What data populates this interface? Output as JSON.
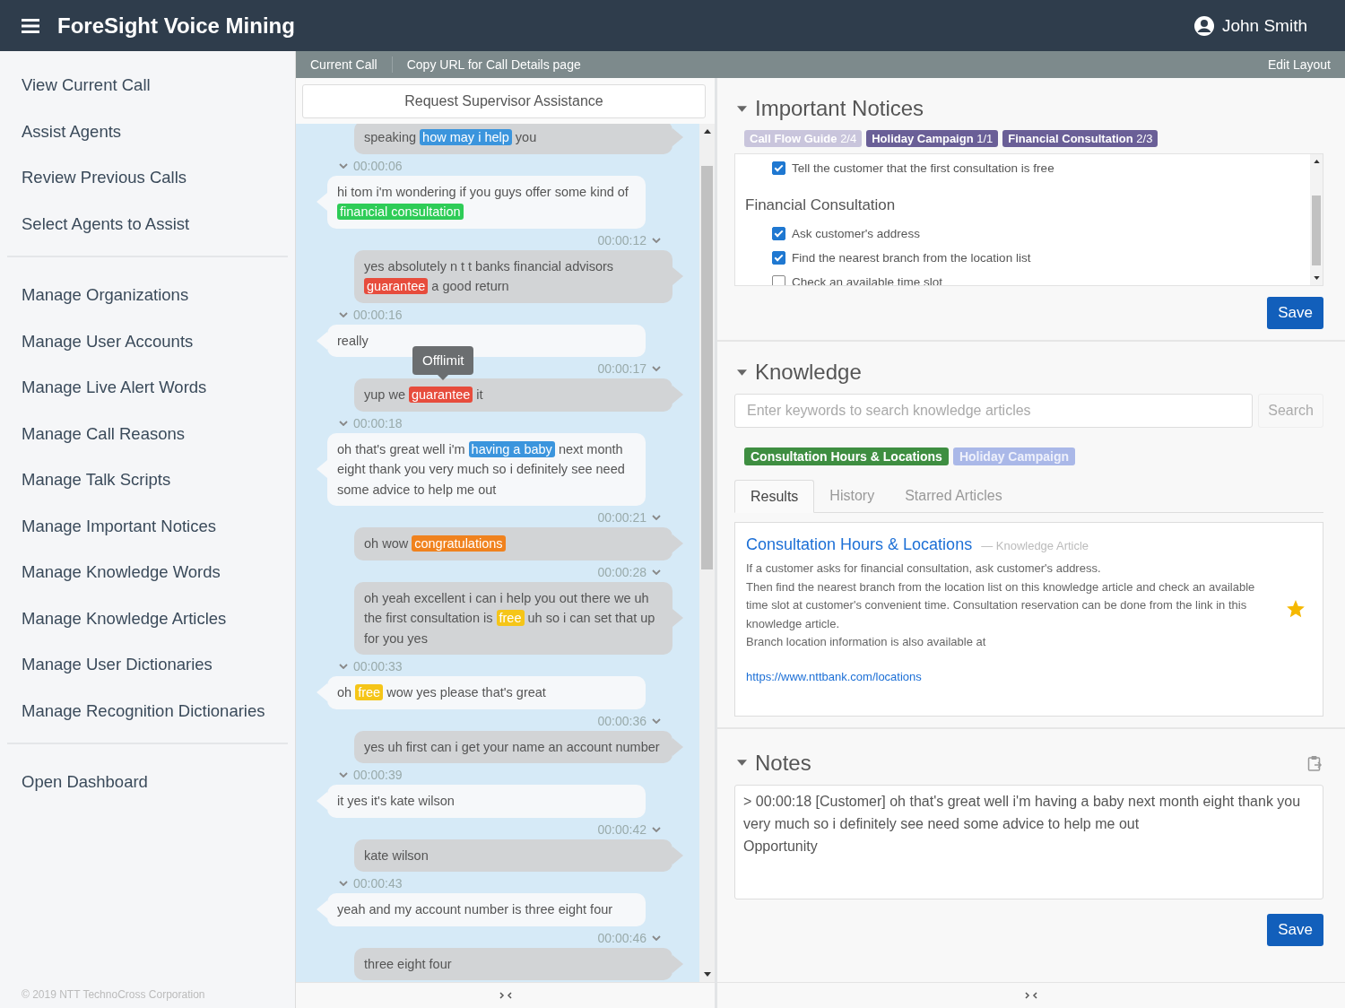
{
  "app": {
    "title": "ForeSight Voice Mining",
    "user": "John Smith"
  },
  "sidebar": {
    "groups": [
      [
        "View Current Call",
        "Assist Agents",
        "Review Previous Calls",
        "Select Agents to Assist"
      ],
      [
        "Manage Organizations",
        "Manage User Accounts",
        "Manage Live Alert Words",
        "Manage Call Reasons",
        "Manage Talk Scripts",
        "Manage Important Notices",
        "Manage Knowledge Words",
        "Manage Knowledge Articles",
        "Manage User Dictionaries",
        "Manage Recognition Dictionaries"
      ],
      [
        "Open Dashboard"
      ]
    ],
    "footer": "© 2019 NTT TechnoCross Corporation"
  },
  "toolbar": {
    "links": [
      "Current Call",
      "Copy URL for Call Details page"
    ],
    "right": "Edit Layout"
  },
  "call": {
    "request_button": "Request Supervisor Assistance",
    "messages": [
      {
        "kind": "agent",
        "segments": [
          {
            "text": "speaking"
          },
          {
            "text": "how may i help",
            "color": "#3b95dd"
          },
          {
            "text": "you"
          }
        ]
      },
      {
        "kind": "customer",
        "time": "00:00:06",
        "segments": [
          {
            "text": "hi tom i'm wondering if you guys offer some kind of"
          },
          {
            "text": "financial consultation",
            "color": "#2ecc57"
          }
        ]
      },
      {
        "kind": "agent",
        "time": "00:00:12",
        "segments": [
          {
            "text": "yes absolutely n t t banks financial advisors"
          },
          {
            "text": "guarantee",
            "color": "#e74c3c"
          },
          {
            "text": "a good return"
          }
        ]
      },
      {
        "kind": "customer",
        "time": "00:00:16",
        "segments": [
          {
            "text": "really"
          }
        ]
      },
      {
        "kind": "agent",
        "time": "00:00:17",
        "tooltip": "Offlimit",
        "segments": [
          {
            "text": "yup we"
          },
          {
            "text": "guarantee",
            "color": "#e74c3c"
          },
          {
            "text": "it"
          }
        ]
      },
      {
        "kind": "customer",
        "time": "00:00:18",
        "segments": [
          {
            "text": "oh that's great well i'm"
          },
          {
            "text": "having a baby",
            "color": "#3b95dd"
          },
          {
            "text": "next month eight thank you very much so i definitely see need some advice to help me out"
          }
        ]
      },
      {
        "kind": "agent",
        "time": "00:00:21",
        "segments": [
          {
            "text": "oh wow"
          },
          {
            "text": "congratulations",
            "color": "#f0821e"
          }
        ]
      },
      {
        "kind": "agent",
        "time": "00:00:28",
        "segments": [
          {
            "text": "oh yeah excellent i can i help you out there we uh the first consultation is"
          },
          {
            "text": "free",
            "color": "#f5c518"
          },
          {
            "text": "uh so i can set that up for you yes"
          }
        ]
      },
      {
        "kind": "customer",
        "time": "00:00:33",
        "segments": [
          {
            "text": "oh"
          },
          {
            "text": "free",
            "color": "#f5c518"
          },
          {
            "text": "wow yes please that's great"
          }
        ]
      },
      {
        "kind": "agent",
        "time": "00:00:36",
        "segments": [
          {
            "text": "yes uh first can i get your name an account number"
          }
        ]
      },
      {
        "kind": "customer",
        "time": "00:00:39",
        "segments": [
          {
            "text": "it yes it's kate wilson"
          }
        ]
      },
      {
        "kind": "agent",
        "time": "00:00:42",
        "segments": [
          {
            "text": "kate wilson"
          }
        ]
      },
      {
        "kind": "customer",
        "time": "00:00:43",
        "segments": [
          {
            "text": "yeah and my account number is three eight four"
          }
        ]
      },
      {
        "kind": "agent",
        "time": "00:00:46",
        "segments": [
          {
            "text": "three eight four"
          }
        ]
      }
    ]
  },
  "notices": {
    "title": "Important Notices",
    "expanded": true,
    "tags": [
      {
        "label": "Call Flow Guide",
        "count": "2/4",
        "active": false
      },
      {
        "label": "Holiday Campaign",
        "count": "1/1",
        "active": true
      },
      {
        "label": "Financial Consultation",
        "count": "2/3",
        "active": true
      }
    ],
    "items": [
      {
        "kind": "check",
        "label": "Tell the customer that the first consultation is free",
        "checked": true
      },
      {
        "kind": "heading",
        "label": "Financial Consultation"
      },
      {
        "kind": "check",
        "label": "Ask customer's address",
        "checked": true
      },
      {
        "kind": "check",
        "label": "Find the nearest branch from the location list",
        "checked": true
      },
      {
        "kind": "check",
        "label": "Check an available time slot",
        "checked": false
      }
    ],
    "save": "Save"
  },
  "knowledge": {
    "title": "Knowledge",
    "expanded": true,
    "search_placeholder": "Enter keywords to search knowledge articles",
    "search_button": "Search",
    "tags": [
      {
        "label": "Consultation Hours & Locations",
        "color": "#3e8e41",
        "active": true
      },
      {
        "label": "Holiday Campaign",
        "color": "#aab8e8",
        "active": false
      }
    ],
    "tabs": [
      {
        "label": "Results",
        "selected": true
      },
      {
        "label": "History",
        "selected": false
      },
      {
        "label": "Starred Articles",
        "selected": false
      }
    ],
    "article": {
      "title": "Consultation Hours & Locations",
      "meta": "— Knowledge Article",
      "starred": true,
      "body": [
        "If a customer asks for financial consultation, ask customer's address.",
        "Then find the nearest branch from the location list on this knowledge article and check an available time slot at customer's convenient time. Consultation reservation can be done from the link in this knowledge article.",
        "Branch location information is also available at"
      ],
      "link": "https://www.nttbank.com/locations"
    }
  },
  "notes": {
    "title": "Notes",
    "expanded": true,
    "value": "> 00:00:18 [Customer] oh that's great well i'm having a baby next month eight thank you very much so i definitely see need some advice to help me out\nOpportunity",
    "save": "Save"
  }
}
